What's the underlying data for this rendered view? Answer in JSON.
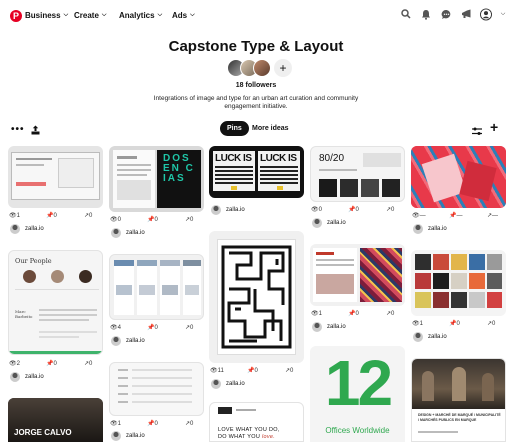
{
  "nav": {
    "logo_letter": "P",
    "items": [
      {
        "label": "Business"
      },
      {
        "label": "Create"
      },
      {
        "label": "Analytics"
      },
      {
        "label": "Ads"
      }
    ]
  },
  "board": {
    "title": "Capstone Type & Layout",
    "followers": "18 followers",
    "description": "Integrations of image and type for an urban art curation and community engagement initiative.",
    "add_collaborator": "+"
  },
  "actions": {
    "more": "•••",
    "tab_active": "Pins",
    "tab_other": "More ideas",
    "add": "+"
  },
  "author_name": "zalla.io",
  "pins": [
    {
      "views": "1",
      "saves": "0",
      "clicks": "0"
    },
    {
      "views": "0",
      "saves": "0",
      "clicks": "0"
    },
    {
      "views": "0",
      "saves": "0",
      "clicks": "0"
    },
    {
      "views": "0",
      "saves": "0",
      "clicks": "0"
    },
    {
      "views": "—",
      "saves": "—",
      "clicks": "—"
    },
    {
      "views": "2",
      "saves": "0",
      "clicks": "0"
    },
    {
      "views": "4",
      "saves": "0",
      "clicks": "0"
    },
    {
      "views": "11",
      "saves": "0",
      "clicks": "0"
    },
    {
      "views": "1",
      "saves": "0",
      "clicks": "0"
    },
    {
      "views": "1",
      "saves": "0",
      "clicks": "0"
    },
    {
      "views": "1",
      "saves": "0",
      "clicks": "0"
    }
  ],
  "pin_text": {
    "our_people": "Our People",
    "ratio": "80/20",
    "luck_is": "LUCK IS",
    "big_number": "12",
    "offices": "Offices Worldwide",
    "love_line1": "LOVE WHAT YOU DO,",
    "love_line2_a": "DO WHAT YOU ",
    "love_line2_b": "love.",
    "jorge": "JORGE CALVO",
    "poster_text": "DOS EN CIAS",
    "mystery_name": "Marc Barbeito",
    "market_caption": "DESIGN + MARCHÉ DE MARQUÉ / MUNICIPALITÉ / MARCHÉS PUBLICS EN MARQUE"
  }
}
